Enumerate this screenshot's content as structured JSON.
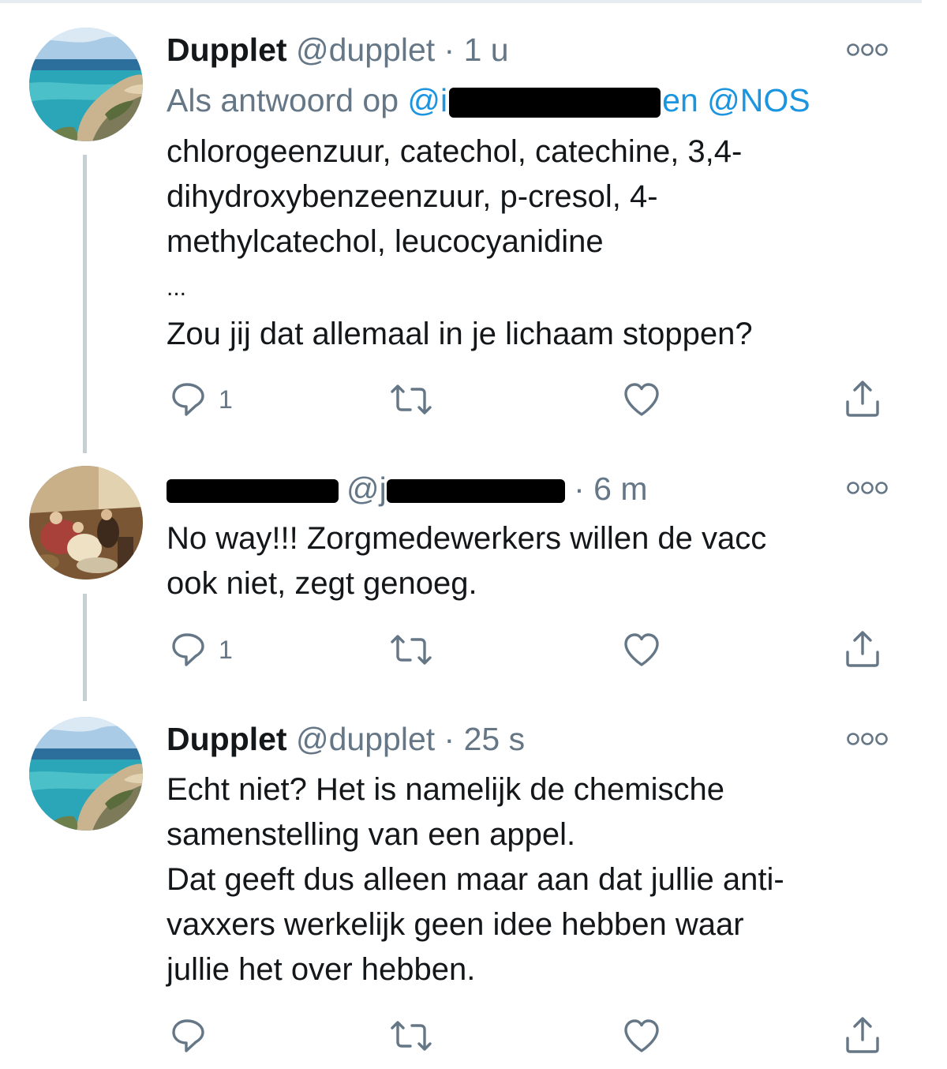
{
  "tweets": [
    {
      "display_name": "Dupplet",
      "handle": "@dupplet",
      "separator": " · ",
      "time": "1 u",
      "avatar": "sea-coast-avatar",
      "reply_prefix": "Als antwoord op ",
      "reply_handle_start": "@i",
      "reply_suffix": "en @NOS",
      "lines": [
        "chlorogeenzuur, catechol, catechine, 3,4-",
        "dihydroxybenzeenzuur, p-cresol, 4-",
        "methylcatechol, leucocyanidine",
        "...",
        "Zou jij dat allemaal in je lichaam stoppen?"
      ],
      "reply_count": "1"
    },
    {
      "display_name_redacted": true,
      "handle_start": "@j",
      "separator": " · ",
      "time": "6 m",
      "avatar": "painting-avatar",
      "lines": [
        "No way!!! Zorgmedewerkers willen de vacc",
        "ook niet, zegt genoeg."
      ],
      "reply_count": "1"
    },
    {
      "display_name": "Dupplet",
      "handle": "@dupplet",
      "separator": " · ",
      "time": "25 s",
      "avatar": "sea-coast-avatar",
      "lines": [
        "Echt niet? Het is namelijk de chemische",
        "samenstelling van een appel.",
        "Dat geeft dus alleen maar aan dat jullie anti-",
        "vaxxers werkelijk geen idee hebben waar",
        "jullie het over hebben."
      ],
      "reply_count": ""
    }
  ],
  "icons": {
    "more": "more-options-icon",
    "reply": "reply-icon",
    "retweet": "retweet-icon",
    "like": "like-icon",
    "share": "share-icon"
  },
  "colors": {
    "text": "#14171a",
    "muted": "#657786",
    "link": "#1b95e0",
    "thread_line": "#c4cfd6",
    "icon": "#657786"
  }
}
